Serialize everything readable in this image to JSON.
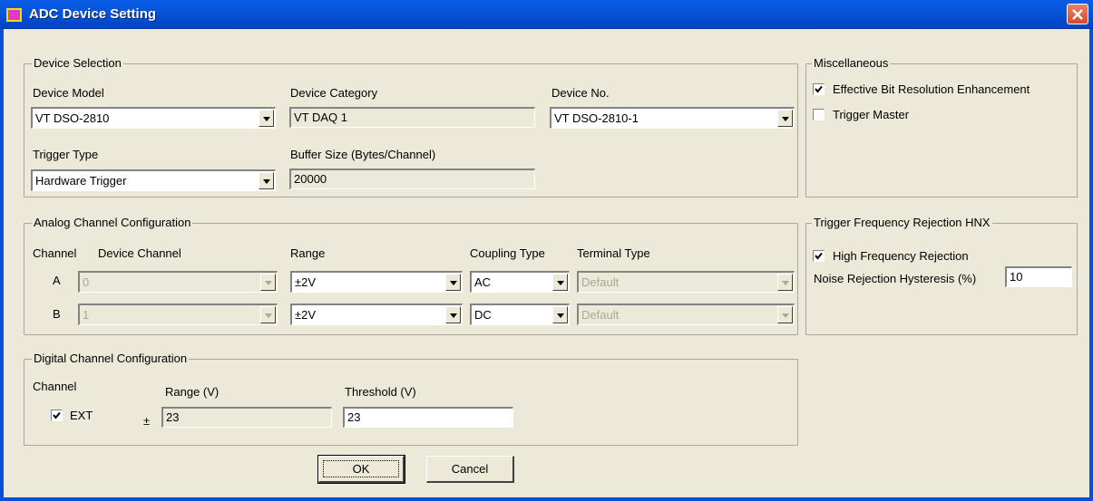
{
  "window": {
    "title": "ADC Device Setting"
  },
  "device_selection": {
    "legend": "Device Selection",
    "model_label": "Device Model",
    "model_value": "VT DSO-2810",
    "category_label": "Device Category",
    "category_value": "VT DAQ 1",
    "no_label": "Device No.",
    "no_value": "VT DSO-2810-1",
    "trigger_label": "Trigger Type",
    "trigger_value": "Hardware Trigger",
    "buffer_label": "Buffer Size (Bytes/Channel)",
    "buffer_value": "20000"
  },
  "misc": {
    "legend": "Miscellaneous",
    "ebre_label": "Effective Bit Resolution Enhancement",
    "ebre_checked": true,
    "trigger_master_label": "Trigger Master",
    "trigger_master_checked": false
  },
  "analog": {
    "legend": "Analog Channel Configuration",
    "headers": {
      "channel": "Channel",
      "device_channel": "Device Channel",
      "range": "Range",
      "coupling": "Coupling Type",
      "terminal": "Terminal Type"
    },
    "rows": [
      {
        "channel": "A",
        "device_channel": "0",
        "range": "±2V",
        "coupling": "AC",
        "terminal": "Default"
      },
      {
        "channel": "B",
        "device_channel": "1",
        "range": "±2V",
        "coupling": "DC",
        "terminal": "Default"
      }
    ]
  },
  "hnx": {
    "legend": "Trigger Frequency Rejection HNX",
    "hfr_label": "High Frequency Rejection",
    "hfr_checked": true,
    "hysteresis_label": "Noise Rejection Hysteresis (%)",
    "hysteresis_value": "10"
  },
  "digital": {
    "legend": "Digital Channel Configuration",
    "channel_label": "Channel",
    "ext_label": "EXT",
    "ext_checked": true,
    "range_label": "Range (V)",
    "plusminus": "±",
    "range_value": "23",
    "threshold_label": "Threshold (V)",
    "threshold_value": "23"
  },
  "buttons": {
    "ok": "OK",
    "cancel": "Cancel"
  }
}
